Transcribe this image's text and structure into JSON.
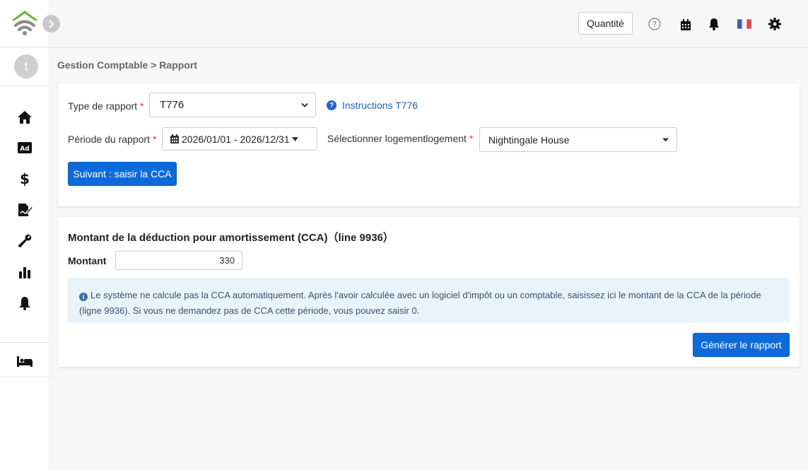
{
  "sidebar": {
    "avatar_initial": "t",
    "nav": [
      "home-icon",
      "ad-icon",
      "dollar-icon",
      "contract-icon",
      "wrench-icon",
      "bar-chart-icon",
      "bell-icon",
      "bed-icon"
    ]
  },
  "header": {
    "quantity_button": "Quantité",
    "icons": [
      "help-circle-icon",
      "calendar-icon",
      "bell-icon",
      "french-flag-icon",
      "gear-icon"
    ]
  },
  "breadcrumb": "Gestion Comptable > Rapport",
  "report_form": {
    "report_type_label": "Type de rapport",
    "report_type_value": "T776",
    "instructions_link": "Instructions T776",
    "period_label": "Période du rapport",
    "period_value": "2026/01/01 - 2026/12/31",
    "lodging_label": "Sélectionner logementlogement",
    "lodging_value": "Nightingale House",
    "next_button": "Suivant : saisir la CCA",
    "required_mark": "*"
  },
  "cca": {
    "title": "Montant de la déduction pour amortissement (CCA)（line 9936）",
    "amount_label": "Montant",
    "amount_value": "330",
    "info_text": "Le système ne calcule pas la CCA automatiquement. Après l'avoir calculée avec un logiciel d'impôt ou un comptable, saisissez ici le montant de la CCA de la période (ligne 9936). Si vous ne demandez pas de CCA cette période, vous pouvez saisir 0.",
    "generate_button": "Générer le rapport"
  },
  "colors": {
    "primary": "#0d6ad9",
    "link": "#1f5fb3",
    "required": "#d9383a",
    "info_bg": "#e8f3fc",
    "logo_green": "#6fb33f"
  }
}
